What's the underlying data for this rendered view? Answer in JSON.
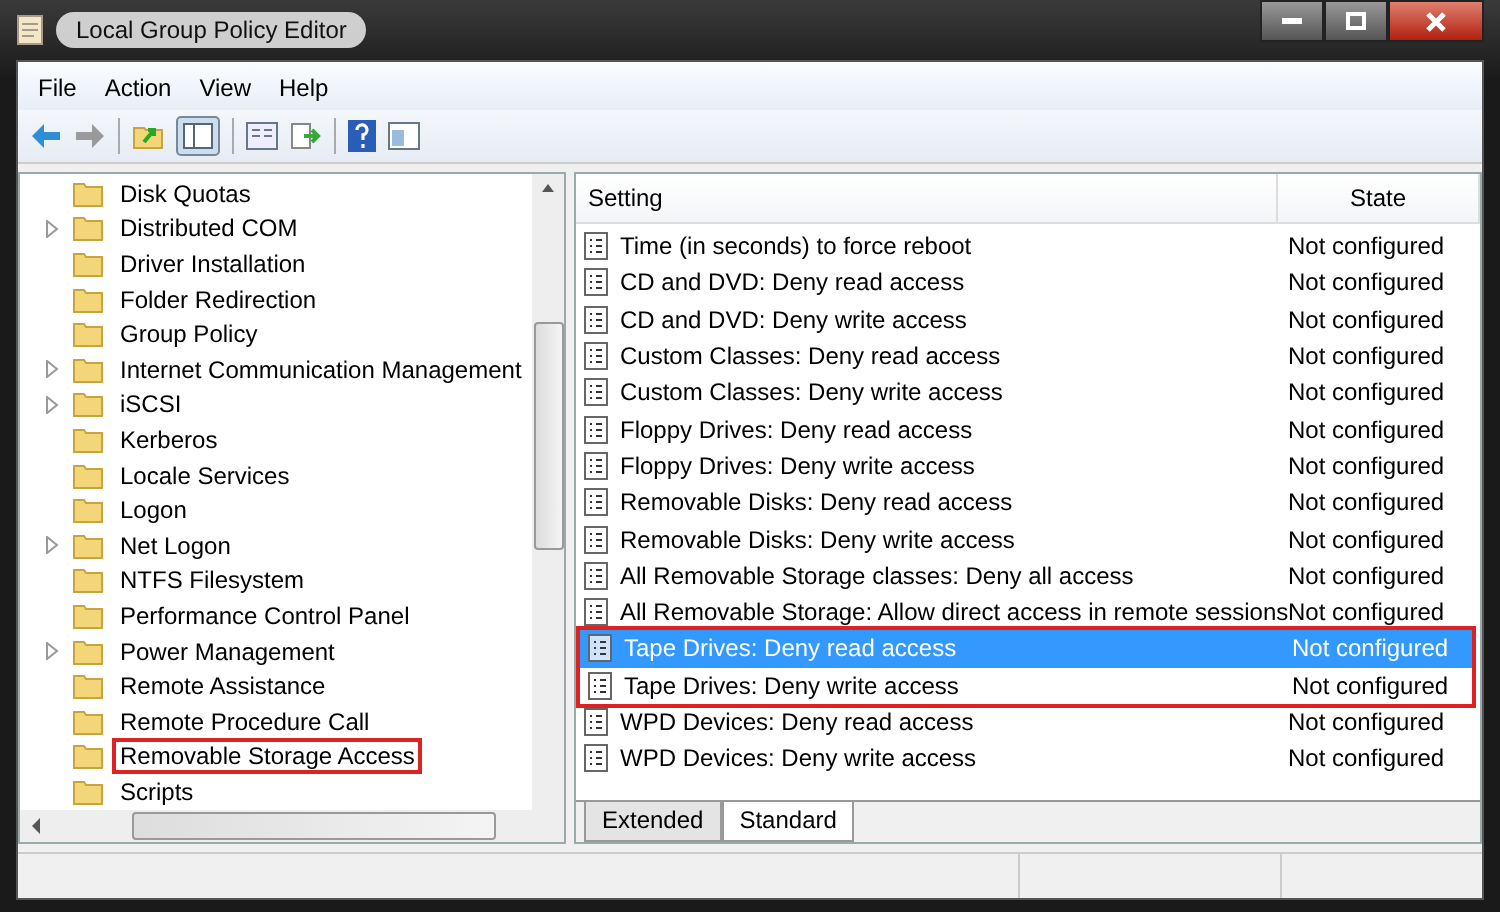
{
  "window": {
    "title": "Local Group Policy Editor"
  },
  "menu": [
    {
      "label": "File"
    },
    {
      "label": "Action"
    },
    {
      "label": "View"
    },
    {
      "label": "Help"
    }
  ],
  "tree": {
    "items": [
      {
        "label": "Disk Quotas",
        "expandable": false,
        "highlighted": false
      },
      {
        "label": "Distributed COM",
        "expandable": true,
        "highlighted": false
      },
      {
        "label": "Driver Installation",
        "expandable": false,
        "highlighted": false
      },
      {
        "label": "Folder Redirection",
        "expandable": false,
        "highlighted": false
      },
      {
        "label": "Group Policy",
        "expandable": false,
        "highlighted": false
      },
      {
        "label": "Internet Communication Management",
        "expandable": true,
        "highlighted": false
      },
      {
        "label": "iSCSI",
        "expandable": true,
        "highlighted": false
      },
      {
        "label": "Kerberos",
        "expandable": false,
        "highlighted": false
      },
      {
        "label": "Locale Services",
        "expandable": false,
        "highlighted": false
      },
      {
        "label": "Logon",
        "expandable": false,
        "highlighted": false
      },
      {
        "label": "Net Logon",
        "expandable": true,
        "highlighted": false
      },
      {
        "label": "NTFS Filesystem",
        "expandable": false,
        "highlighted": false
      },
      {
        "label": "Performance Control Panel",
        "expandable": false,
        "highlighted": false
      },
      {
        "label": "Power Management",
        "expandable": true,
        "highlighted": false
      },
      {
        "label": "Remote Assistance",
        "expandable": false,
        "highlighted": false
      },
      {
        "label": "Remote Procedure Call",
        "expandable": false,
        "highlighted": false
      },
      {
        "label": "Removable Storage Access",
        "expandable": false,
        "highlighted": true
      },
      {
        "label": "Scripts",
        "expandable": false,
        "highlighted": false
      }
    ]
  },
  "table": {
    "columns": [
      "Setting",
      "State"
    ],
    "rows": [
      {
        "setting": "Time (in seconds) to force reboot",
        "state": "Not configured",
        "selected": false,
        "highlighted": false
      },
      {
        "setting": "CD and DVD: Deny read access",
        "state": "Not configured",
        "selected": false,
        "highlighted": false
      },
      {
        "setting": "CD and DVD: Deny write access",
        "state": "Not configured",
        "selected": false,
        "highlighted": false
      },
      {
        "setting": "Custom Classes: Deny read access",
        "state": "Not configured",
        "selected": false,
        "highlighted": false
      },
      {
        "setting": "Custom Classes: Deny write access",
        "state": "Not configured",
        "selected": false,
        "highlighted": false
      },
      {
        "setting": "Floppy Drives: Deny read access",
        "state": "Not configured",
        "selected": false,
        "highlighted": false
      },
      {
        "setting": "Floppy Drives: Deny write access",
        "state": "Not configured",
        "selected": false,
        "highlighted": false
      },
      {
        "setting": "Removable Disks: Deny read access",
        "state": "Not configured",
        "selected": false,
        "highlighted": false
      },
      {
        "setting": "Removable Disks: Deny write access",
        "state": "Not configured",
        "selected": false,
        "highlighted": false
      },
      {
        "setting": "All Removable Storage classes: Deny all access",
        "state": "Not configured",
        "selected": false,
        "highlighted": false
      },
      {
        "setting": "All Removable Storage: Allow direct access in remote sessions",
        "state": "Not configured",
        "selected": false,
        "highlighted": false
      },
      {
        "setting": "Tape Drives: Deny read access",
        "state": "Not configured",
        "selected": true,
        "highlighted": true
      },
      {
        "setting": "Tape Drives: Deny write access",
        "state": "Not configured",
        "selected": false,
        "highlighted": true
      },
      {
        "setting": "WPD Devices: Deny read access",
        "state": "Not configured",
        "selected": false,
        "highlighted": false
      },
      {
        "setting": "WPD Devices: Deny write access",
        "state": "Not configured",
        "selected": false,
        "highlighted": false
      }
    ]
  },
  "tabs": [
    {
      "label": "Extended",
      "selected": false
    },
    {
      "label": "Standard",
      "selected": true
    }
  ]
}
